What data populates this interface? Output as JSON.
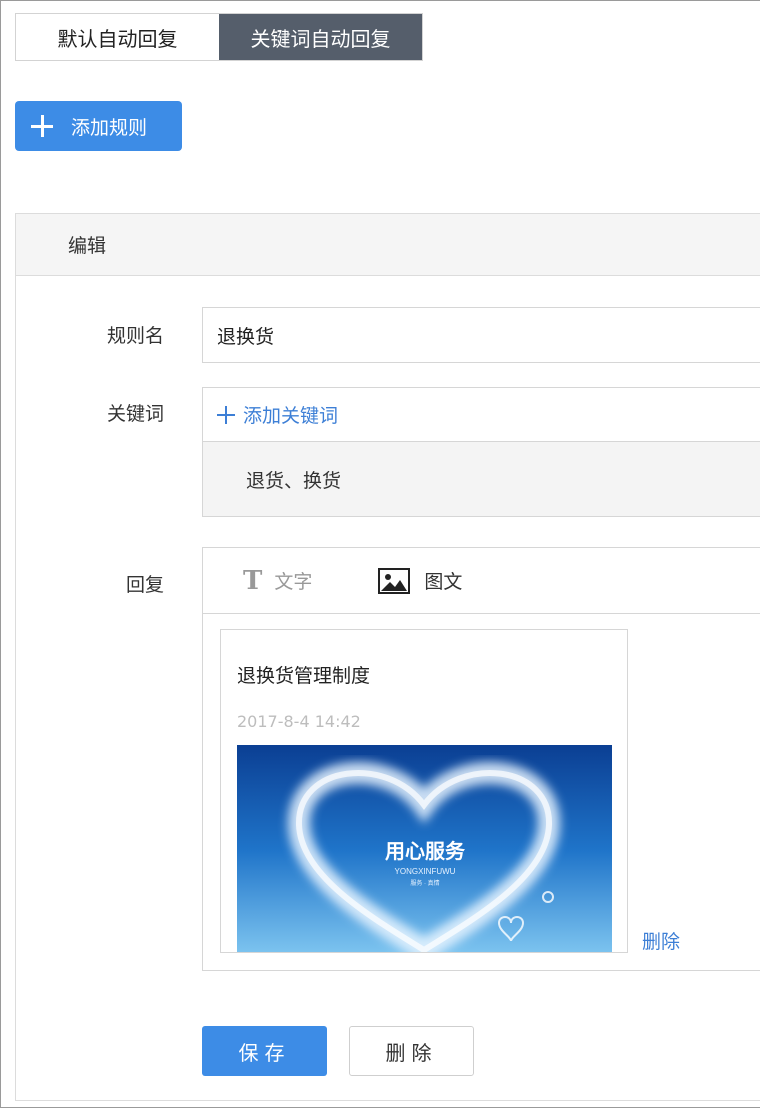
{
  "tabs": [
    {
      "label": "默认自动回复",
      "active": false
    },
    {
      "label": "关键词自动回复",
      "active": true
    }
  ],
  "add_rule": {
    "label": "添加规则",
    "icon": "plus-icon"
  },
  "panel": {
    "header": "编辑"
  },
  "rule_name": {
    "label": "规则名",
    "value": "退换货"
  },
  "keywords": {
    "label": "关键词",
    "add_label": "添加关键词",
    "list": "退货、换货"
  },
  "reply": {
    "label": "回复",
    "tabs": [
      {
        "icon": "text-icon",
        "glyph": "T",
        "label": "文字"
      },
      {
        "icon": "image-icon",
        "label": "图文"
      }
    ],
    "card": {
      "title": "退换货管理制度",
      "date": "2017-8-4 14:42",
      "image_caption": "用心服务",
      "image_subcaption": "YONGXINFUWU",
      "image_small": "服务 · 真情"
    },
    "delete_label": "删除"
  },
  "buttons": {
    "save": "保存",
    "delete": "删除"
  },
  "colors": {
    "primary": "#3d8ce6",
    "link": "#3d7fd6",
    "active_tab": "#555e6b"
  }
}
